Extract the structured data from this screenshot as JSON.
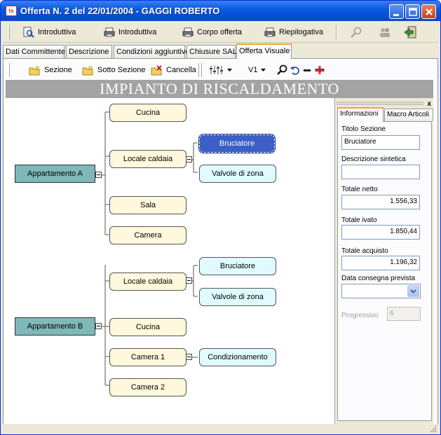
{
  "window": {
    "title": "Offerta N. 2 del 22/01/2004 - GAGGI ROBERTO",
    "app_icon_text": "ts"
  },
  "toolbar1": {
    "buttons": [
      {
        "label": "Introduttiva",
        "icon": "preview-icon"
      },
      {
        "label": "Introduttiva",
        "icon": "printer-icon"
      },
      {
        "label": "Corpo offerta",
        "icon": "printer-icon"
      },
      {
        "label": "Riepilogativa",
        "icon": "printer-icon"
      }
    ]
  },
  "tabs": [
    "Dati Committente",
    "Descrizione",
    "Condizioni aggiuntive",
    "Chiusure SAL",
    "Offerta Visuale"
  ],
  "toolbar2": {
    "sezione": "Sezione",
    "sotto_sezione": "Sotto Sezione",
    "cancella": "Cancella",
    "version": "V1"
  },
  "banner": "IMPIANTO DI RISCALDAMENTO",
  "tree": {
    "a": {
      "label": "Appartamento A",
      "cucina": "Cucina",
      "locale_caldaia": "Locale caldaia",
      "bruciatore": "Bruciatore",
      "valvole": "Valvole di zona",
      "sala": "Sala",
      "camera": "Camera"
    },
    "b": {
      "label": "Appartamento B",
      "locale_caldaia": "Locale caldaia",
      "bruciatore": "Bruciatore",
      "valvole": "Valvole di zona",
      "cucina": "Cucina",
      "camera1": "Camera 1",
      "condizionamento": "Condizionamento",
      "camera2": "Camera 2"
    }
  },
  "panel": {
    "close": "x",
    "tabs": [
      "Informazioni",
      "Macro Articoli"
    ],
    "titolo_label": "Titolo Sezione",
    "titolo_value": "Bruciatore",
    "descr_label": "Descrizione sintetica",
    "descr_value": "",
    "netto_label": "Totale netto",
    "netto_value": "1.556,33",
    "ivato_label": "Totale ivato",
    "ivato_value": "1.850,44",
    "acquisto_label": "Totale acquisto",
    "acquisto_value": "1.196,32",
    "consegna_label": "Data consegna prevista",
    "consegna_value": "",
    "progressivo_label": "Progressivo",
    "progressivo_value": "6"
  },
  "colors": {
    "titlebar": "#0a5ce0",
    "selected_node": "#3b5fc4",
    "section_node": "#7fb8b8",
    "leaf_node": "#fff8dc",
    "child_node": "#e0fbff",
    "active_tab_accent": "#f2a33a"
  }
}
